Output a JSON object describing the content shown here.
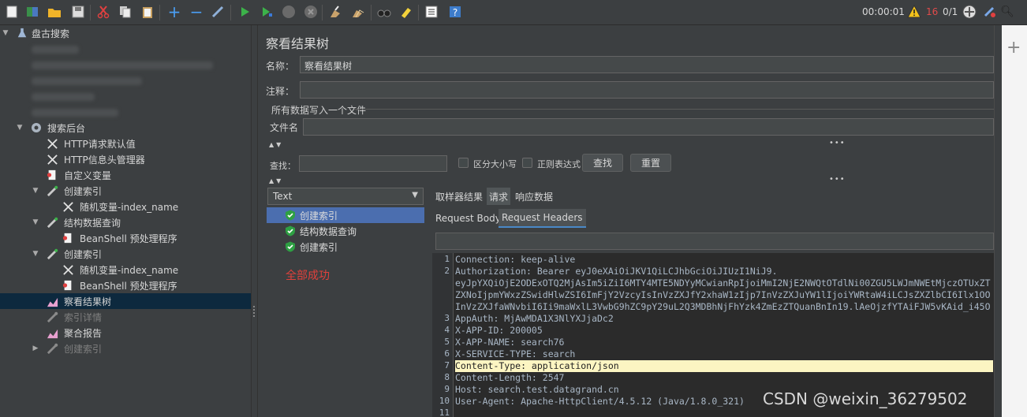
{
  "toolbar": {
    "timer": "00:00:01",
    "error_count": "16",
    "threads": "0/1"
  },
  "tree": {
    "root_label": "盘古搜索",
    "group_label": "搜索后台",
    "items": [
      {
        "label": "HTTP请求默认值"
      },
      {
        "label": "HTTP信息头管理器"
      },
      {
        "label": "自定义变量"
      },
      {
        "label": "创建索引"
      },
      {
        "label": "随机变量-index_name"
      },
      {
        "label": "结构数据查询"
      },
      {
        "label": "BeanShell 预处理程序"
      },
      {
        "label": "创建索引"
      },
      {
        "label": "随机变量-index_name"
      },
      {
        "label": "BeanShell 预处理程序"
      },
      {
        "label": "察看结果树"
      },
      {
        "label": "索引详情"
      },
      {
        "label": "聚合报告"
      },
      {
        "label": "创建索引"
      }
    ]
  },
  "panel": {
    "title": "察看结果树",
    "name_label": "名称：",
    "name_value": "察看结果树",
    "comment_label": "注释：",
    "comment_value": "",
    "file_group": "所有数据写入一个文件",
    "filename_label": "文件名",
    "filename_value": "",
    "search_label": "查找：",
    "case_label": "区分大小写",
    "regex_label": "正则表达式",
    "find_button": "查找",
    "reset_button": "重置",
    "render_select": "Text",
    "results": [
      {
        "label": "创建索引"
      },
      {
        "label": "结构数据查询"
      },
      {
        "label": "创建索引"
      }
    ],
    "status": "全部成功",
    "tabs": [
      "取样器结果",
      "请求",
      "响应数据"
    ],
    "subtabs": [
      "Request Body",
      "Request Headers"
    ]
  },
  "code": {
    "line_numbers": [
      "1",
      "2",
      "",
      "",
      "",
      "3",
      "4",
      "5",
      "6",
      "7",
      "8",
      "9",
      "10",
      "11"
    ],
    "lines": [
      "Connection: keep-alive",
      "Authorization: Bearer eyJ0eXAiOiJKV1QiLCJhbGciOiJIUzI1NiJ9.",
      "eyJpYXQiOjE2ODExOTQ2MjAsIm5iZiI6MTY4MTE5NDYyMCwianRpIjoiMmI2NjE2NWQtOTdlNi00ZGU5LWJmNWEtMjczOTUxZT",
      "ZXNoIjpmYWxzZSwidHlwZSI6ImFjY2VzcyIsInVzZXJfY2xhaW1zIjp7InVzZXJuYW1lIjoiYWRtaW4iLCJsZXZlbCI6Ilx1OO",
      "InVzZXJfaWNvbiI6Ii9maWxlL3VwbG9hZC9pY29uL2Q3MDBhNjFhYzk4ZmEzZTQuanBnIn19.lAeOjzfYTAiFJW5vKAid_i45O",
      "AppAuth: MjAwMDA1X3NlYXJjaDc2",
      "X-APP-ID: 200005",
      "X-APP-NAME: search76",
      "X-SERVICE-TYPE: search",
      "Content-Type: application/json",
      "Content-Length: 2547",
      "Host: search.test.datagrand.cn",
      "User-Agent: Apache-HttpClient/4.5.12 (Java/1.8.0_321)",
      ""
    ]
  },
  "watermark": "CSDN @weixin_36279502"
}
